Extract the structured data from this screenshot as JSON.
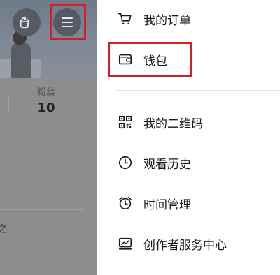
{
  "profile": {
    "fans_label": "粉丝",
    "fans_count": "10",
    "partial_text": "之"
  },
  "drawer": {
    "items": [
      {
        "label": "我的订单",
        "icon": "cart-icon"
      },
      {
        "label": "钱包",
        "icon": "wallet-icon"
      },
      {
        "label": "我的二维码",
        "icon": "qr-code-icon"
      },
      {
        "label": "观看历史",
        "icon": "clock-icon"
      },
      {
        "label": "时间管理",
        "icon": "alarm-clock-icon"
      },
      {
        "label": "创作者服务中心",
        "icon": "chart-icon"
      }
    ]
  },
  "colors": {
    "highlight": "#d31f25",
    "overlay": "#8b8b8b",
    "text": "#161616"
  }
}
